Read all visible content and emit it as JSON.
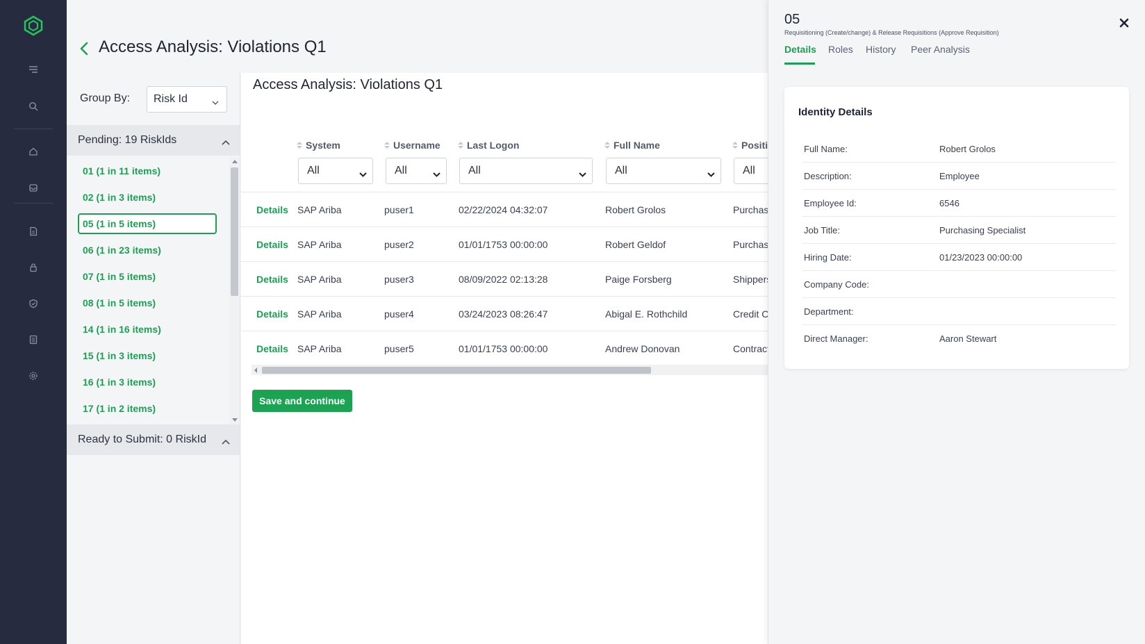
{
  "nav": {
    "icons": [
      "app-logo-icon",
      "menu-icon",
      "search-icon",
      "home-icon",
      "inbox-icon",
      "document-icon",
      "lock-icon",
      "shield-icon",
      "report-icon",
      "settings-icon"
    ]
  },
  "header": {
    "title": "Access Analysis: Violations Q1"
  },
  "group_panel": {
    "group_by_label": "Group By:",
    "group_by_value": "Risk Id",
    "pending_label": "Pending: 19 RiskIds",
    "items": [
      "01 (1 in 11 items)",
      "02 (1 in 3 items)",
      "05 (1 in 5 items)",
      "06 (1 in 23 items)",
      "07 (1 in 5 items)",
      "08 (1 in 5 items)",
      "14 (1 in 16 items)",
      "15 (1 in 3 items)",
      "16 (1 in 3 items)",
      "17 (1 in 2 items)"
    ],
    "selected_item": "05 (1 in 5 items)",
    "ready_label": "Ready to Submit: 0 RiskId"
  },
  "main": {
    "title": "Access Analysis: Violations Q1",
    "columns": [
      "System",
      "Username",
      "Last Logon",
      "Full Name",
      "Positi"
    ],
    "filter_value": "All",
    "rows": [
      {
        "action": "Details",
        "system": "SAP Ariba",
        "username": "puser1",
        "last_logon": "02/22/2024 04:32:07",
        "full_name": "Robert Grolos",
        "position": "Purchasi"
      },
      {
        "action": "Details",
        "system": "SAP Ariba",
        "username": "puser2",
        "last_logon": "01/01/1753 00:00:00",
        "full_name": "Robert Geldof",
        "position": "Purchasi"
      },
      {
        "action": "Details",
        "system": "SAP Ariba",
        "username": "puser3",
        "last_logon": "08/09/2022 02:13:28",
        "full_name": "Paige Forsberg",
        "position": "Shippers"
      },
      {
        "action": "Details",
        "system": "SAP Ariba",
        "username": "puser4",
        "last_logon": "03/24/2023 08:26:47",
        "full_name": "Abigal E. Rothchild",
        "position": "Credit C"
      },
      {
        "action": "Details",
        "system": "SAP Ariba",
        "username": "puser5",
        "last_logon": "01/01/1753 00:00:00",
        "full_name": "Andrew Donovan",
        "position": "Contract"
      }
    ],
    "save_label": "Save and continue"
  },
  "drawer": {
    "id": "05",
    "subtitle": "Requisitioning (Create/change) & Release Requisitions (Approve Requisition)",
    "tabs": [
      "Details",
      "Roles",
      "History",
      "Peer Analysis"
    ],
    "active_tab": "Details",
    "card_title": "Identity Details",
    "fields": [
      {
        "label": "Full Name:",
        "value": "Robert Grolos"
      },
      {
        "label": "Description:",
        "value": "Employee"
      },
      {
        "label": "Employee Id:",
        "value": "6546"
      },
      {
        "label": "Job Title:",
        "value": "Purchasing Specialist"
      },
      {
        "label": "Hiring Date:",
        "value": "01/23/2023 00:00:00"
      },
      {
        "label": "Company Code:",
        "value": ""
      },
      {
        "label": "Department:",
        "value": ""
      },
      {
        "label": "Direct Manager:",
        "value": "Aaron Stewart"
      }
    ]
  },
  "colors": {
    "accent": "#1f9d55",
    "button": "#1ba353",
    "rail": "#262b40"
  }
}
